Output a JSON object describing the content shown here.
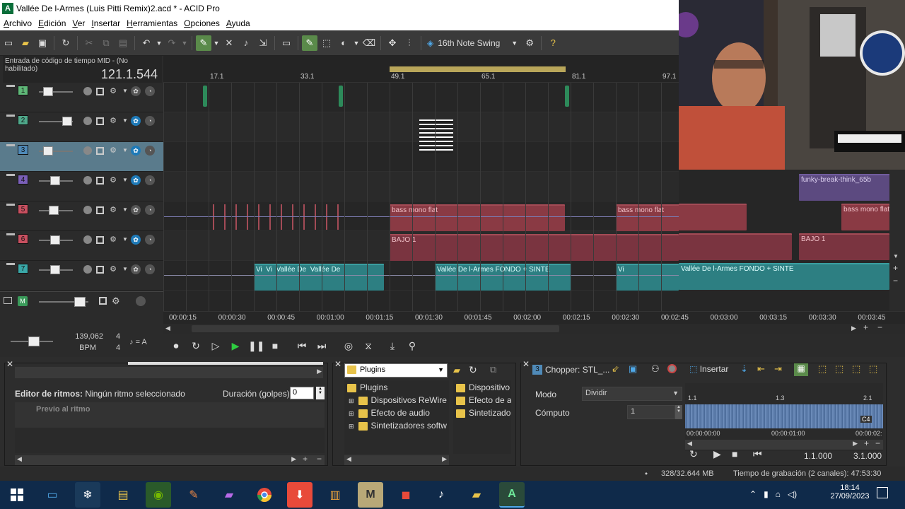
{
  "window": {
    "title": "Vallée De l-Armes (Luis Pitti Remix)2.acd * - ACID Pro",
    "app_icon": "A"
  },
  "menu": [
    "Archivo",
    "Edición",
    "Ver",
    "Insertar",
    "Herramientas",
    "Opciones",
    "Ayuda"
  ],
  "toolbar": {
    "swing_label": "16th Note Swing"
  },
  "timecode": {
    "label": "Entrada de código de tiempo MID - (No habilitado)",
    "value": "121.1.544"
  },
  "tracks": [
    {
      "num": "1",
      "color": "#5fb878"
    },
    {
      "num": "2",
      "color": "#4fa88a"
    },
    {
      "num": "3",
      "color": "#4f8ab8"
    },
    {
      "num": "4",
      "color": "#7a5fb8"
    },
    {
      "num": "5",
      "color": "#c85060"
    },
    {
      "num": "6",
      "color": "#c85060"
    },
    {
      "num": "7",
      "color": "#3aa8a8"
    }
  ],
  "tempo": {
    "bpm_value": "139,062",
    "bpm_label": "BPM",
    "time_sig_top": "4",
    "time_sig_bottom": "4",
    "key_label": "= A"
  },
  "ruler": {
    "bars": [
      "17.1",
      "33.1",
      "49.1",
      "65.1",
      "81.1",
      "97.1"
    ]
  },
  "clips": {
    "bass": "bass mono flat",
    "bajo": "BAJO 1",
    "vallee_short": "Vallée De",
    "vallee_long": "Vallée De l-Armes FONDO + SINTE",
    "funky": "funky-break-think_65b",
    "vi": "Vi"
  },
  "time_ruler": [
    "00:00:15",
    "00:00:30",
    "00:00:45",
    "00:01:00",
    "00:01:15",
    "00:01:30",
    "00:01:45",
    "00:02:00",
    "00:02:15",
    "00:02:30",
    "00:02:45",
    "00:03:00",
    "00:03:15",
    "00:03:30",
    "00:03:45"
  ],
  "beat_panel": {
    "editor_label": "Editor de ritmos:",
    "editor_value": "Ningún ritmo seleccionado",
    "duration_label": "Duración (golpes):",
    "duration_value": "0",
    "preview_label": "Previo al ritmo"
  },
  "plugins_panel": {
    "dropdown": "Plugins",
    "root": "Plugins",
    "items": [
      "Dispositivos ReWire",
      "Efecto de audio",
      "Sintetizadores softw"
    ],
    "right_items": [
      "Dispositivo",
      "Efecto de a",
      "Sintetizado"
    ]
  },
  "chopper": {
    "track_num": "3",
    "title": "Chopper: STL_...",
    "insert_label": "Insertar",
    "mode_label": "Modo",
    "mode_value": "Dividir",
    "count_label": "Cómputo",
    "count_value": "1",
    "bars": [
      "1.1",
      "1.3",
      "2.1"
    ],
    "times": [
      "00:00:00:00",
      "00:00:01:00",
      "00:00:02:"
    ],
    "note": "C4",
    "pos_start": "1.1.000",
    "pos_end": "3.1.000"
  },
  "status": {
    "memory": "328/32.644 MB",
    "record_time": "Tiempo de grabación (2 canales): 47:53:30"
  },
  "taskbar": {
    "time": "18:14",
    "date": "27/09/2023"
  }
}
